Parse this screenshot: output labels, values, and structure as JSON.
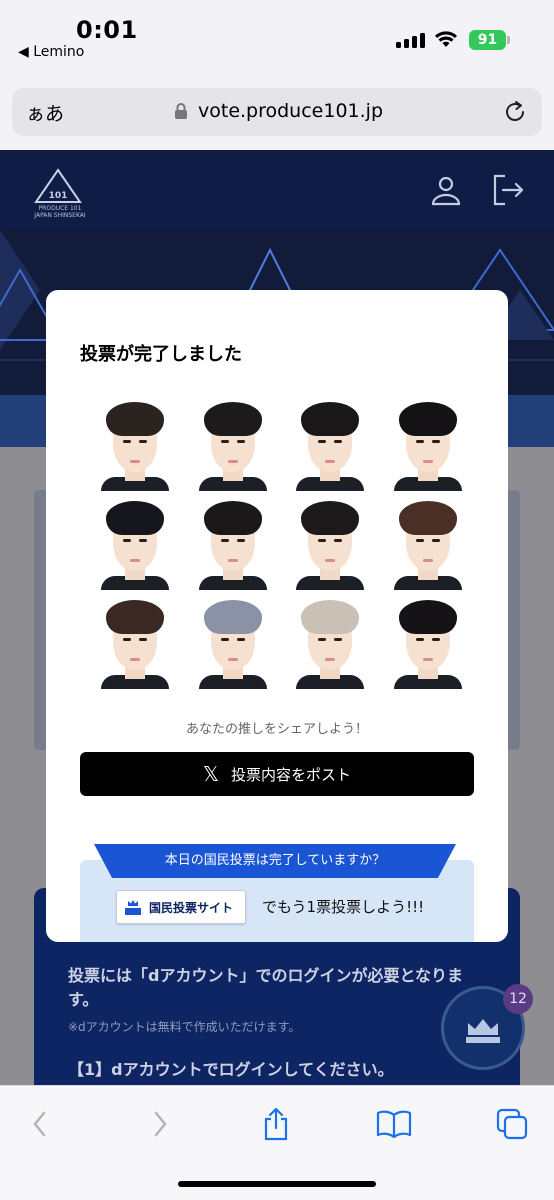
{
  "status_bar": {
    "time": "0:01",
    "back_app": "◀ Lemino",
    "battery": "91"
  },
  "browser": {
    "text_size_label": "ぁあ",
    "url": "vote.produce101.jp"
  },
  "site": {
    "logo_text": "PRODUCE 101 JAPAN SHINSEKAI",
    "login_notice": "投票には「dアカウント」でのログインが必要となります。",
    "login_note_small": "※dアカウントは無料で作成いただけます。",
    "step1": "【1】dアカウントでログインしてください。",
    "fab_badge": "12"
  },
  "modal": {
    "title": "投票が完了しました",
    "share_hint": "あなたの推しをシェアしよう！",
    "post_button_label": "投票内容をポスト",
    "ribbon_text": "本日の国民投票は完了していますか？",
    "vote_site_label": "国民投票サイト",
    "vote_cta": "でもう1票投票しよう!!!",
    "trainees": [
      {
        "hair": "#2b2320"
      },
      {
        "hair": "#1d1a1c"
      },
      {
        "hair": "#1a1718"
      },
      {
        "hair": "#141214"
      },
      {
        "hair": "#16171c"
      },
      {
        "hair": "#1b1819"
      },
      {
        "hair": "#1c1a1b"
      },
      {
        "hair": "#4a2f27"
      },
      {
        "hair": "#3a2823"
      },
      {
        "hair": "#8c92a6"
      },
      {
        "hair": "#c9c0b6"
      },
      {
        "hair": "#151316"
      }
    ]
  },
  "colors": {
    "header_bg": "#0f1c45",
    "post_button_bg": "#000000",
    "ribbon_bg": "#1a55d4",
    "battery_green": "#34c759"
  }
}
